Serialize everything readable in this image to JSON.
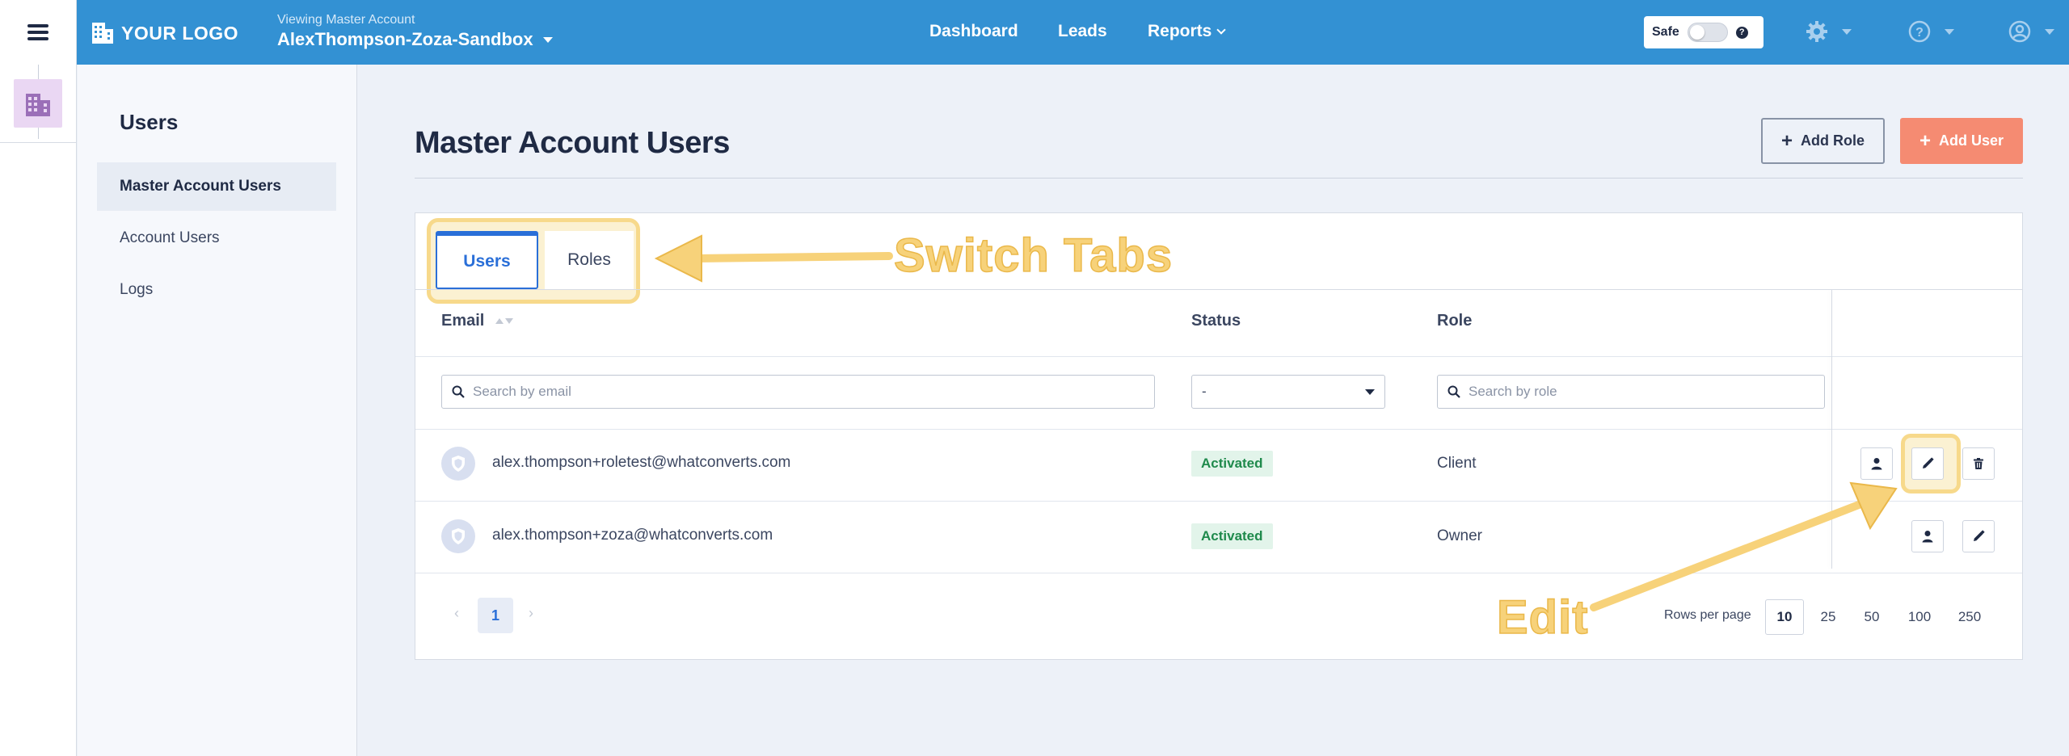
{
  "topbar": {
    "logo_text": "YOUR LOGO",
    "account_caption": "Viewing Master Account",
    "account_name": "AlexThompson-Zoza-Sandbox",
    "nav": [
      "Dashboard",
      "Leads",
      "Reports"
    ],
    "safe_label": "Safe",
    "safe_help": "?",
    "color": "#3391d3"
  },
  "sidebar": {
    "title": "Users",
    "items": [
      {
        "label": "Master Account Users",
        "active": true
      },
      {
        "label": "Account Users",
        "active": false
      },
      {
        "label": "Logs",
        "active": false
      }
    ]
  },
  "main": {
    "title": "Master Account Users",
    "add_role_label": "Add Role",
    "add_user_label": "Add User",
    "tabs": [
      {
        "label": "Users",
        "active": true
      },
      {
        "label": "Roles",
        "active": false
      }
    ],
    "columns": [
      "Email",
      "Status",
      "Role"
    ],
    "filters": {
      "email_placeholder": "Search by email",
      "status_value": "-",
      "role_placeholder": "Search by role"
    },
    "rows": [
      {
        "email": "alex.thompson+roletest@whatconverts.com",
        "status": "Activated",
        "role": "Client"
      },
      {
        "email": "alex.thompson+zoza@whatconverts.com",
        "status": "Activated",
        "role": "Owner"
      }
    ],
    "pagination": {
      "prev": "‹",
      "current": "1",
      "next": "›",
      "rows_per_page_label": "Rows per page",
      "rows_per_page_options": [
        "10",
        "25",
        "50",
        "100",
        "250"
      ],
      "rows_per_page_selected": "10"
    }
  },
  "annotations": {
    "switch_tabs": "Switch Tabs",
    "edit": "Edit",
    "color": "#f7d27a"
  },
  "icons": [
    "menu-icon",
    "building-icon",
    "gear-icon",
    "help-icon",
    "user-circle-icon",
    "search-icon",
    "shield-icon",
    "person-icon",
    "pencil-icon",
    "trash-icon"
  ]
}
